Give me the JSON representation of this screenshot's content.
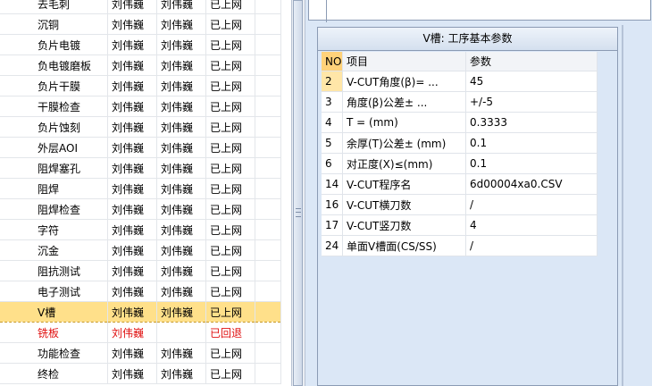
{
  "process_list": {
    "rows": [
      {
        "name": "去毛刺",
        "c1": "刘伟巍",
        "c2": "刘伟巍",
        "status": "已上网",
        "state": "normal"
      },
      {
        "name": "沉铜",
        "c1": "刘伟巍",
        "c2": "刘伟巍",
        "status": "已上网",
        "state": "normal"
      },
      {
        "name": "负片电镀",
        "c1": "刘伟巍",
        "c2": "刘伟巍",
        "status": "已上网",
        "state": "normal"
      },
      {
        "name": "负电镀磨板",
        "c1": "刘伟巍",
        "c2": "刘伟巍",
        "status": "已上网",
        "state": "normal"
      },
      {
        "name": "负片干膜",
        "c1": "刘伟巍",
        "c2": "刘伟巍",
        "status": "已上网",
        "state": "normal"
      },
      {
        "name": "干膜检查",
        "c1": "刘伟巍",
        "c2": "刘伟巍",
        "status": "已上网",
        "state": "normal"
      },
      {
        "name": "负片蚀刻",
        "c1": "刘伟巍",
        "c2": "刘伟巍",
        "status": "已上网",
        "state": "normal"
      },
      {
        "name": "外层AOI",
        "c1": "刘伟巍",
        "c2": "刘伟巍",
        "status": "已上网",
        "state": "normal"
      },
      {
        "name": "阻焊塞孔",
        "c1": "刘伟巍",
        "c2": "刘伟巍",
        "status": "已上网",
        "state": "normal"
      },
      {
        "name": "阻焊",
        "c1": "刘伟巍",
        "c2": "刘伟巍",
        "status": "已上网",
        "state": "normal"
      },
      {
        "name": "阻焊检查",
        "c1": "刘伟巍",
        "c2": "刘伟巍",
        "status": "已上网",
        "state": "normal"
      },
      {
        "name": "字符",
        "c1": "刘伟巍",
        "c2": "刘伟巍",
        "status": "已上网",
        "state": "normal"
      },
      {
        "name": "沉金",
        "c1": "刘伟巍",
        "c2": "刘伟巍",
        "status": "已上网",
        "state": "normal"
      },
      {
        "name": "阻抗测试",
        "c1": "刘伟巍",
        "c2": "刘伟巍",
        "status": "已上网",
        "state": "normal"
      },
      {
        "name": "电子测试",
        "c1": "刘伟巍",
        "c2": "刘伟巍",
        "status": "已上网",
        "state": "normal"
      },
      {
        "name": "V槽",
        "c1": "刘伟巍",
        "c2": "刘伟巍",
        "status": "已上网",
        "state": "selected"
      },
      {
        "name": "铣板",
        "c1": "刘伟巍",
        "c2": "",
        "status": "已回退",
        "state": "red"
      },
      {
        "name": "功能检查",
        "c1": "刘伟巍",
        "c2": "刘伟巍",
        "status": "已上网",
        "state": "normal"
      },
      {
        "name": "终检",
        "c1": "刘伟巍",
        "c2": "刘伟巍",
        "status": "已上网",
        "state": "normal"
      }
    ]
  },
  "param_panel": {
    "title": "V槽: 工序基本参数",
    "headers": {
      "no": "NO",
      "item": "项目",
      "value": "参数"
    },
    "rows": [
      {
        "no": "2",
        "item": "V-CUT角度(β)=  ...",
        "value": "45",
        "current": true
      },
      {
        "no": "3",
        "item": "角度(β)公差±  ...",
        "value": "+/-5"
      },
      {
        "no": "4",
        "item": "T =  (mm)",
        "value": "0.3333"
      },
      {
        "no": "5",
        "item": "余厚(T)公差±  (mm)",
        "value": "0.1"
      },
      {
        "no": "6",
        "item": "对正度(X)≤(mm)",
        "value": "0.1"
      },
      {
        "no": "14",
        "item": "V-CUT程序名",
        "value": "6d00004xa0.CSV"
      },
      {
        "no": "16",
        "item": "V-CUT横刀数",
        "value": "/"
      },
      {
        "no": "17",
        "item": "V-CUT竖刀数",
        "value": "4"
      },
      {
        "no": "24",
        "item": "单面V槽面(CS/SS)",
        "value": "/"
      }
    ]
  },
  "colors": {
    "selected_row": "#ffe08a",
    "rollback_text": "#e01010",
    "panel_bg": "#dbe7f6"
  }
}
